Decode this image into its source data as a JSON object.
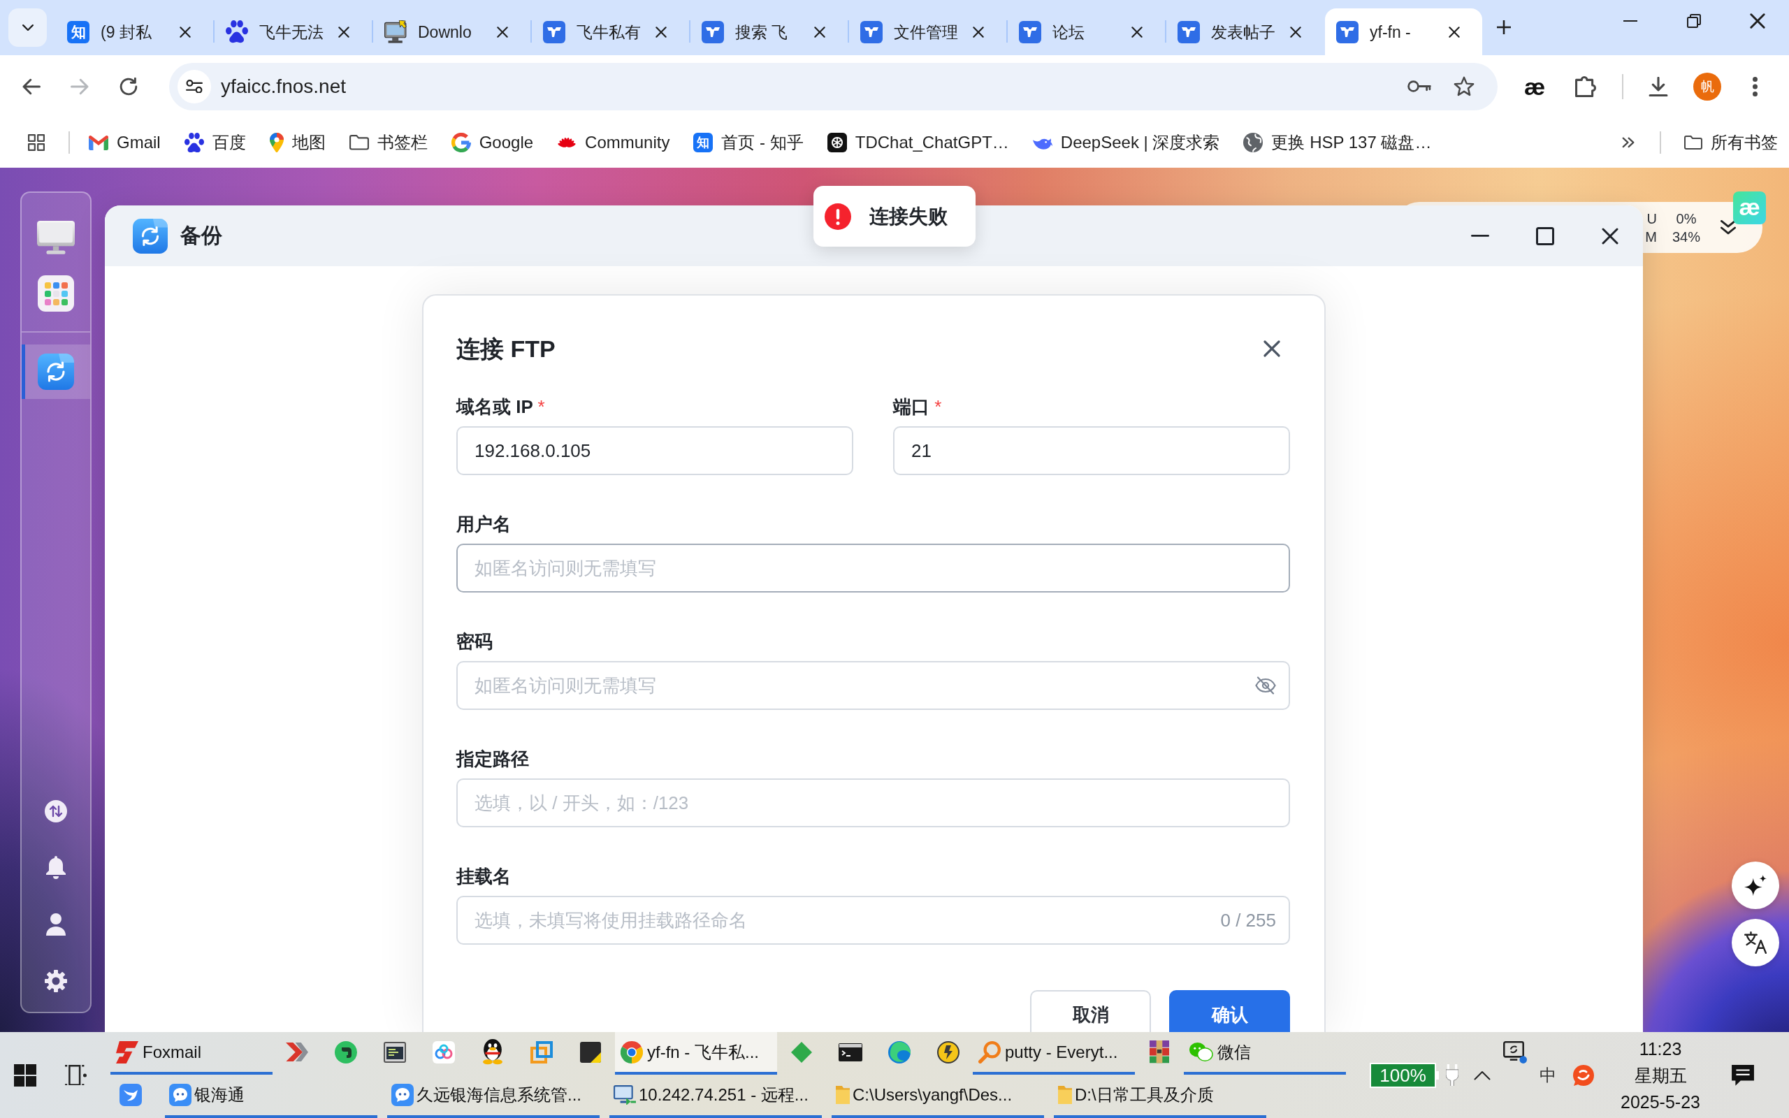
{
  "browser": {
    "tabs": [
      {
        "title": "(9 封私",
        "kind": "letter",
        "glyph": "知",
        "selected": false
      },
      {
        "title": "飞牛无法",
        "kind": "paw",
        "selected": false
      },
      {
        "title": "Downlo",
        "kind": "pc",
        "selected": false
      },
      {
        "title": "飞牛私有",
        "kind": "bull",
        "selected": false
      },
      {
        "title": "搜索 飞",
        "kind": "bull",
        "selected": false
      },
      {
        "title": "文件管理",
        "kind": "bull",
        "selected": false
      },
      {
        "title": "论坛",
        "kind": "bull",
        "selected": false
      },
      {
        "title": "发表帖子",
        "kind": "bull",
        "selected": false
      },
      {
        "title": "yf-fn -",
        "kind": "bull",
        "selected": true
      }
    ],
    "navigation": [
      {
        "kind": "back",
        "disabled": false
      },
      {
        "kind": "forward",
        "disabled": true
      },
      {
        "kind": "reload",
        "disabled": false
      }
    ],
    "address": "yfaicc.fnos.net",
    "extension_glyph": "æ",
    "avatar": "帆",
    "bookmarks": [
      {
        "kind": "mail",
        "label": "Gmail"
      },
      {
        "kind": "paw",
        "label": "百度"
      },
      {
        "kind": "pin",
        "label": "地图"
      },
      {
        "kind": "folder",
        "label": "书签栏"
      },
      {
        "kind": "ring",
        "label": "Google"
      },
      {
        "kind": "flower",
        "label": "Community"
      },
      {
        "kind": "letter",
        "glyph": "知",
        "label": "首页 - 知乎"
      },
      {
        "kind": "knot",
        "label": "TDChat_ChatGPT…"
      },
      {
        "kind": "whale",
        "label": "DeepSeek | 深度求索"
      },
      {
        "kind": "globe",
        "label": "更换 HSP 137 磁盘…"
      }
    ],
    "all_bookmarks": "所有书签"
  },
  "desktop": {
    "dock": {
      "pinned": [
        {
          "kind": "monitor",
          "selected": false
        },
        {
          "kind": "grid",
          "selected": false
        }
      ],
      "open": [
        {
          "kind": "sync",
          "selected": true
        }
      ],
      "tools": [
        {
          "kind": "transfer"
        },
        {
          "kind": "bell"
        },
        {
          "kind": "user"
        },
        {
          "kind": "gear"
        }
      ]
    },
    "toast": {
      "kind": "error",
      "message": "连接失败"
    },
    "monitor_widget": {
      "labels": [
        "U",
        "M"
      ],
      "values": [
        "0%",
        "34%"
      ]
    },
    "corner_app": {
      "glyph": "æ"
    },
    "side_buttons": [
      {
        "kind": "sparkle"
      },
      {
        "kind": "translate"
      }
    ],
    "window": {
      "title": "备份",
      "dialog": {
        "title": "连接 FTP",
        "rows": [
          [
            {
              "kind": "text",
              "label": "域名或 IP",
              "mark": "*",
              "value": "192.168.0.105",
              "focused": false
            },
            {
              "kind": "text",
              "label": "端口",
              "mark": "*",
              "value": "21",
              "focused": false
            }
          ],
          [
            {
              "kind": "text",
              "label": "用户名",
              "placeholder": "如匿名访问则无需填写",
              "focused": true
            }
          ],
          [
            {
              "kind": "password",
              "label": "密码",
              "placeholder": "如匿名访问则无需填写",
              "focused": false
            }
          ],
          [
            {
              "kind": "text",
              "label": "指定路径",
              "placeholder": "选填，以 / 开头，如：/123",
              "focused": false
            }
          ],
          [
            {
              "kind": "text",
              "label": "挂载名",
              "placeholder": "选填，未填写将使用挂载路径命名",
              "counter": "0 / 255",
              "focused": false
            }
          ]
        ],
        "buttons": [
          {
            "label": "取消",
            "kind": "secondary"
          },
          {
            "label": "确认",
            "kind": "primary"
          }
        ]
      }
    }
  },
  "taskbar": {
    "rows": [
      [
        {
          "kind": "fox",
          "label": "Foxmail",
          "running": true,
          "active": false
        },
        {
          "kind": "arrows",
          "running": false,
          "active": false
        },
        {
          "kind": "elephant",
          "running": false,
          "active": false
        },
        {
          "kind": "appwin",
          "running": false,
          "active": false
        },
        {
          "kind": "cloud",
          "running": false,
          "active": false
        },
        {
          "kind": "penguin",
          "running": false,
          "active": false
        },
        {
          "kind": "squares",
          "running": false,
          "active": false
        },
        {
          "kind": "note",
          "running": false,
          "active": false
        },
        {
          "kind": "browser",
          "label": "yf-fn - 飞牛私...",
          "running": true,
          "active": true
        },
        {
          "kind": "diamond",
          "running": false,
          "active": false
        },
        {
          "kind": "terminal",
          "running": false,
          "active": false
        },
        {
          "kind": "swirl",
          "running": false,
          "active": false
        },
        {
          "kind": "ue",
          "running": false,
          "active": false
        },
        {
          "kind": "magnifier",
          "label": "putty - Everyt...",
          "running": true,
          "active": false
        },
        {
          "kind": "archive",
          "running": false,
          "active": false
        },
        {
          "kind": "chat",
          "label": "微信",
          "running": true,
          "active": false
        }
      ],
      [
        {
          "kind": "bird",
          "running": false,
          "active": false
        },
        {
          "kind": "bubble",
          "label": "银海通",
          "running": true,
          "active": false
        },
        {
          "kind": "bubble",
          "label": "久远银海信息系统管...",
          "running": true,
          "active": false
        },
        {
          "kind": "remote",
          "label": "10.242.74.251 - 远程...",
          "running": true,
          "active": false
        },
        {
          "kind": "folder",
          "label": "C:\\Users\\yangf\\Des...",
          "running": true,
          "active": false
        },
        {
          "kind": "folder",
          "label": "D:\\日常工具及介质",
          "running": true,
          "active": false
        }
      ]
    ],
    "tray": {
      "battery": "100%",
      "ime": "中",
      "time": "11:23",
      "weekday": "星期五",
      "date": "2025-5-23"
    }
  }
}
